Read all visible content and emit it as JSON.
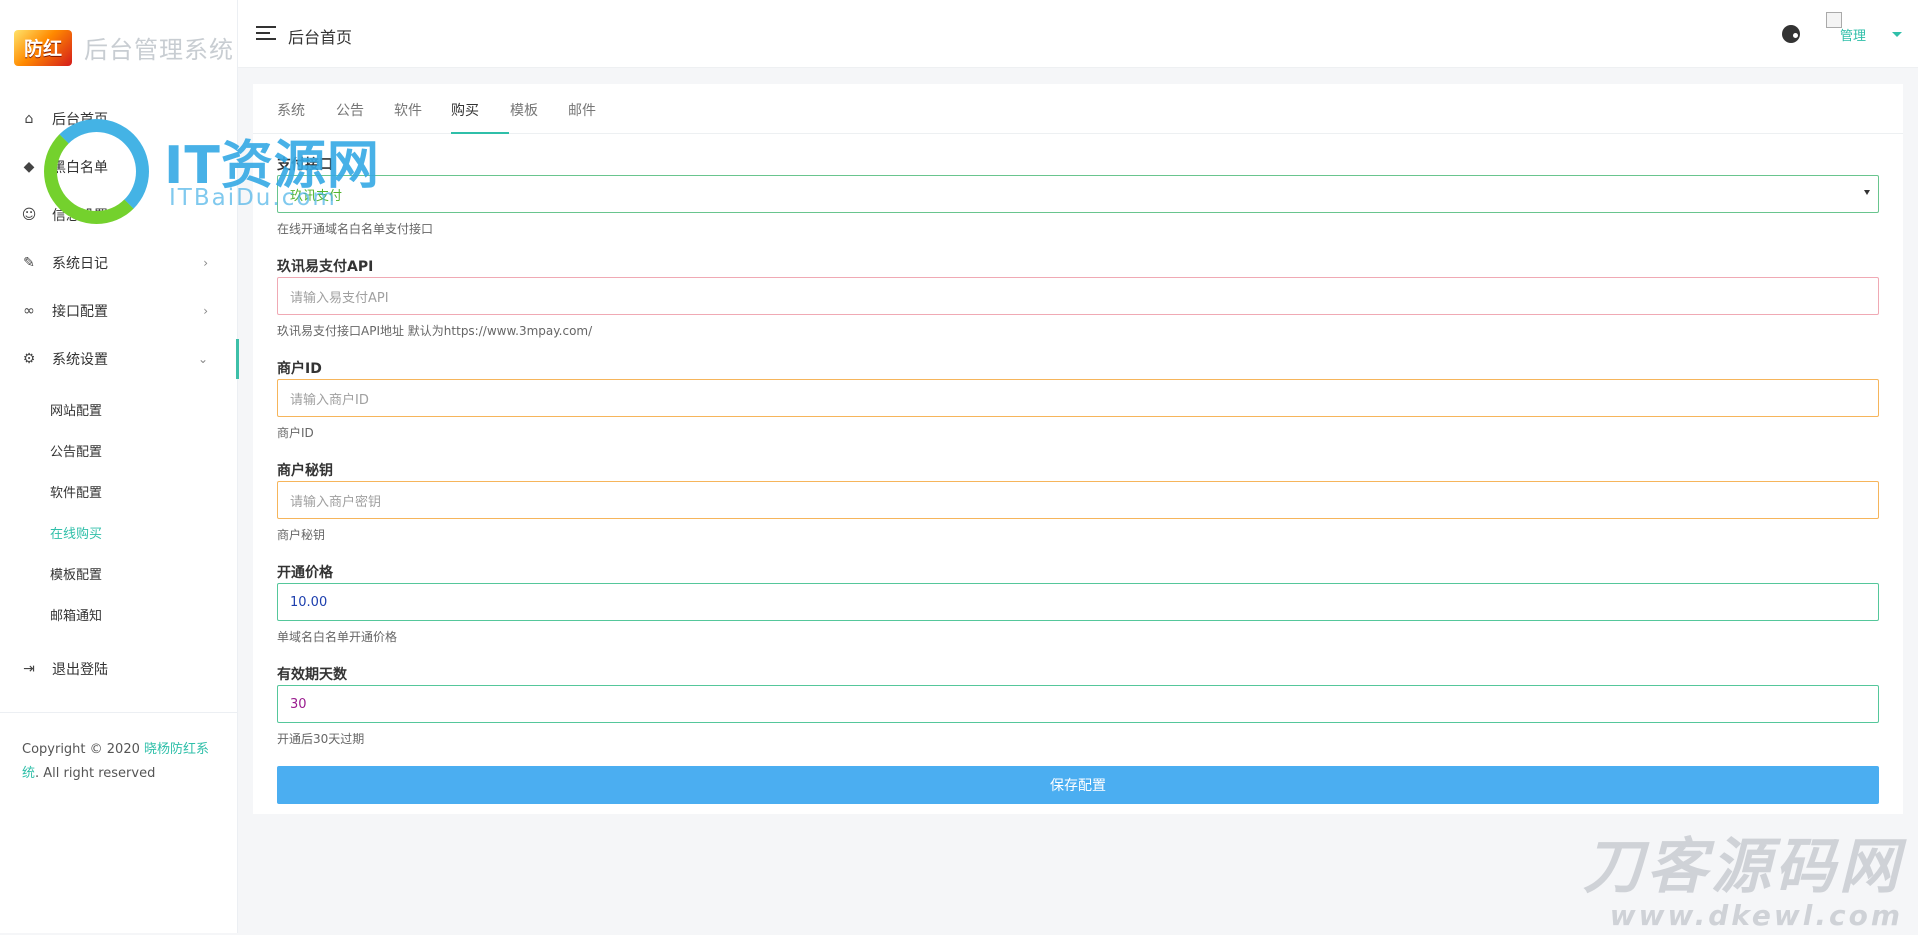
{
  "brand": {
    "logo_text": "防红",
    "title": "后台管理系统"
  },
  "header": {
    "title": "后台首页",
    "user_name": "管理"
  },
  "nav": {
    "items": [
      {
        "label": "后台首页",
        "icon": "home-icon"
      },
      {
        "label": "黑白名单",
        "icon": "shield-icon"
      },
      {
        "label": "信息设置",
        "icon": "smile-icon"
      },
      {
        "label": "系统日记",
        "icon": "pencil-icon"
      },
      {
        "label": "接口配置",
        "icon": "link-icon"
      },
      {
        "label": "系统设置",
        "icon": "gear-icon"
      }
    ],
    "subitems": [
      "网站配置",
      "公告配置",
      "软件配置",
      "在线购买",
      "模板配置",
      "邮箱通知"
    ],
    "logout": "退出登陆"
  },
  "copyright": {
    "line": "Copyright © 2020 ",
    "link": "晓杨防红系统",
    "tail": ". All right reserved"
  },
  "tabs": [
    "系统",
    "公告",
    "软件",
    "购买",
    "模板",
    "邮件"
  ],
  "form": {
    "payment": {
      "label": "支付接口",
      "value": "玖讯支付",
      "help": "在线开通域名白名单支付接口"
    },
    "api": {
      "label": "玖讯易支付API",
      "placeholder": "请输入易支付API",
      "help": "玖讯易支付接口API地址 默认为https://www.3mpay.com/"
    },
    "merchant_id": {
      "label": "商户ID",
      "placeholder": "请输入商户ID",
      "help": "商户ID"
    },
    "merchant_key": {
      "label": "商户秘钥",
      "placeholder": "请输入商户密钥",
      "help": "商户秘钥"
    },
    "price": {
      "label": "开通价格",
      "value": "10.00",
      "help": "单域名白名单开通价格"
    },
    "days": {
      "label": "有效期天数",
      "value": "30",
      "help": "开通后30天过期"
    },
    "save": "保存配置"
  },
  "watermarks": {
    "a_big": "IT资源网",
    "a_small": "ITBaiDu.com",
    "b_big": "刀客源码网",
    "b_small": "www.dkewl.com"
  },
  "colors": {
    "accent": "#2fbfa9",
    "button": "#4baef1",
    "background": "#f5f6f8"
  }
}
